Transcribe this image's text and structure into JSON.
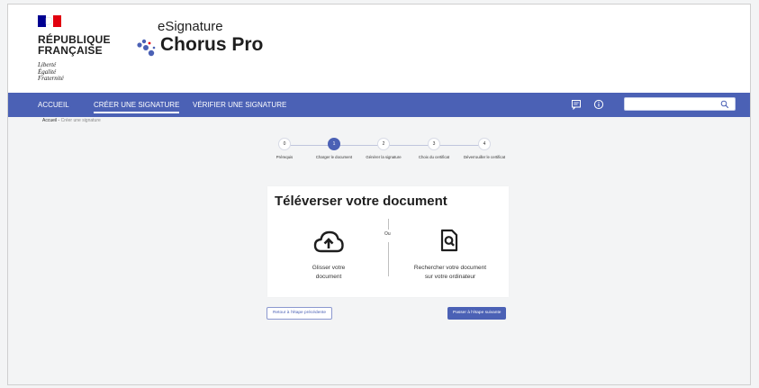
{
  "header": {
    "rf_name_line1": "RÉPUBLIQUE",
    "rf_name_line2": "FRANÇAISE",
    "devise_1": "Liberté",
    "devise_2": "Égalité",
    "devise_3": "Fraternité",
    "brand_sub": "eSignature",
    "brand_main": "Chorus Pro"
  },
  "nav": {
    "items": [
      {
        "label": "ACCUEIL"
      },
      {
        "label": "CRÉER UNE SIGNATURE"
      },
      {
        "label": "VÉRIFIER UNE SIGNATURE"
      }
    ],
    "active_index": 1,
    "search_placeholder": ""
  },
  "breadcrumb": {
    "home": "Accueil",
    "separator": " - ",
    "current": "Créer une signature"
  },
  "stepper": {
    "steps": [
      {
        "number": "0",
        "label": "Prérequis"
      },
      {
        "number": "1",
        "label": "Charger le document"
      },
      {
        "number": "2",
        "label": "Générer la signature"
      },
      {
        "number": "3",
        "label": "Choix du certificat"
      },
      {
        "number": "4",
        "label": "Déverrouiller le certificat"
      }
    ],
    "active_index": 1
  },
  "card": {
    "title": "Téléverser votre document",
    "or_label": "Ou",
    "upload_line1": "Glisser votre",
    "upload_line2": "document",
    "browse_line1": "Rechercher votre document",
    "browse_line2": "sur votre ordinateur"
  },
  "buttons": {
    "back": "Retour à l'étape précédente",
    "next": "Passer à l'étape suivante"
  },
  "colors": {
    "accent": "#4b61b5",
    "flag_blue": "#000091",
    "flag_red": "#e1000f"
  }
}
